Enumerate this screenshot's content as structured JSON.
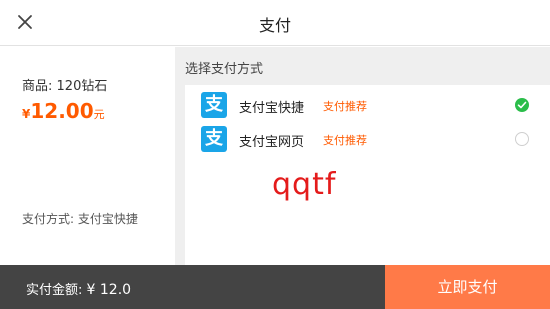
{
  "header": {
    "title": "支付",
    "close_icon": "close-icon"
  },
  "order": {
    "product_label": "商品:",
    "product_name": "120钻石",
    "currency": "¥",
    "price": "12.00",
    "price_unit": "元",
    "method_label": "支付方式:",
    "method_value": "支付宝快捷"
  },
  "payment": {
    "section_label": "选择支付方式",
    "options": [
      {
        "name": "支付宝快捷",
        "tag": "支付推荐",
        "icon": "alipay-icon",
        "icon_glyph": "支",
        "selected": true
      },
      {
        "name": "支付宝网页",
        "tag": "支付推荐",
        "icon": "alipay-icon",
        "icon_glyph": "支",
        "selected": false
      }
    ]
  },
  "watermark": "qqtf",
  "footer": {
    "total_label": "实付金额:",
    "total_value": "¥ 12.0",
    "pay_button": "立即支付"
  },
  "colors": {
    "accent_orange": "#ff5a00",
    "pay_button": "#ff7a48",
    "footer_bg": "#444444",
    "alipay_blue": "#1aa5e8",
    "check_green": "#2bbd4a",
    "watermark_red": "#e41b1b"
  }
}
